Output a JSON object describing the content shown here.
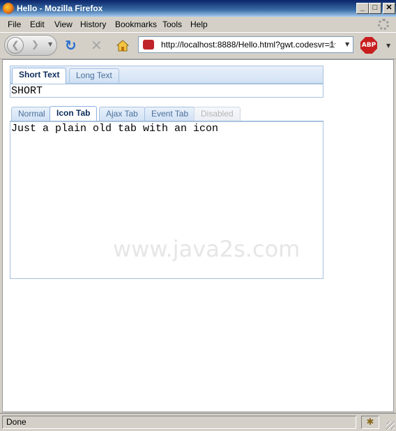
{
  "window": {
    "title": "Hello - Mozilla Firefox"
  },
  "menu": [
    "File",
    "Edit",
    "View",
    "History",
    "Bookmarks",
    "Tools",
    "Help"
  ],
  "toolbar": {
    "url": "http://localhost:8888/Hello.html?gwt.codesvr=1",
    "adblock_label": "ABP"
  },
  "top_tabs": {
    "tabs": [
      "Short Text",
      "Long Text"
    ],
    "selected": "Short Text",
    "panel_text": "SHORT"
  },
  "bottom_tabs": {
    "tabs": [
      "Normal",
      "Icon Tab",
      "Ajax Tab",
      "Event Tab",
      "Disabled"
    ],
    "selected": "Icon Tab",
    "disabled": "Disabled",
    "panel_text": "Just a plain old tab with an icon"
  },
  "watermark": "www.java2s.com",
  "status": {
    "text": "Done"
  },
  "colors": {
    "tab_border": "#a8c1de",
    "selected_tab_text": "#0c2b5a",
    "tab_text": "#4a6f9a"
  }
}
